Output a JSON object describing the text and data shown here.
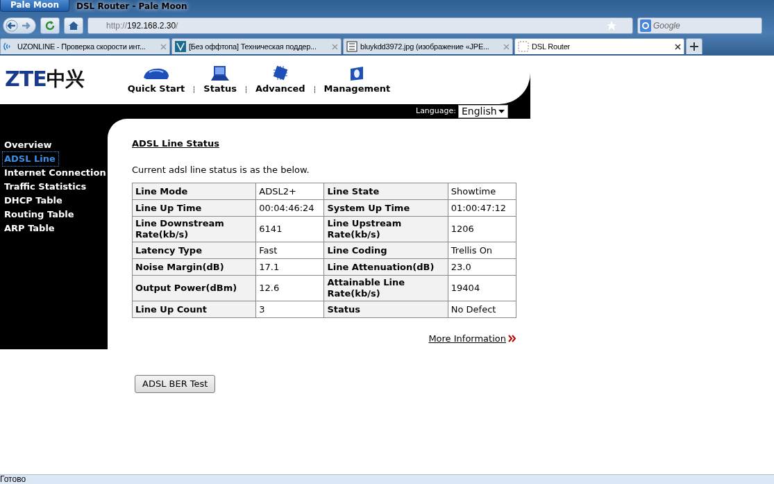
{
  "window": {
    "app_button": "Pale Moon",
    "title": "DSL Router - Pale Moon"
  },
  "toolbar": {
    "url_scheme": "http://",
    "url_host": "192.168.2.30",
    "url_rest": "/",
    "search_placeholder": "Google"
  },
  "tabs": [
    {
      "label": "UZONLINE - Проверка скорости инт...",
      "selected": false,
      "kind": "waves"
    },
    {
      "label": "[Без оффтопа] Техническая поддер...",
      "selected": false,
      "kind": "v"
    },
    {
      "label": "bluykdd3972.jpg (изображение «JPE...",
      "selected": false,
      "kind": "image"
    },
    {
      "label": "DSL Router",
      "selected": true,
      "kind": "blank"
    }
  ],
  "page": {
    "logo_latin": "ZTE",
    "logo_cjk": "中兴",
    "menu": [
      {
        "label": "Quick Start",
        "kind": "start"
      },
      {
        "label": "Status",
        "kind": "status"
      },
      {
        "label": "Advanced",
        "kind": "advanced"
      },
      {
        "label": "Management",
        "kind": "management"
      }
    ],
    "language_label": "Language:",
    "language_value": "English",
    "sidebar": [
      {
        "label": "Overview",
        "selected": false
      },
      {
        "label": "ADSL Line",
        "selected": true
      },
      {
        "label": "Internet Connection",
        "selected": false
      },
      {
        "label": "Traffic Statistics",
        "selected": false
      },
      {
        "label": "DHCP Table",
        "selected": false
      },
      {
        "label": "Routing Table",
        "selected": false
      },
      {
        "label": "ARP Table",
        "selected": false
      }
    ],
    "heading": "ADSL Line Status",
    "intro": "Current adsl line status is as the below.",
    "table": {
      "rows": [
        [
          "Line Mode",
          "ADSL2+",
          "Line State",
          "Showtime"
        ],
        [
          "Line Up Time",
          "00:04:46:24",
          "System Up Time",
          "01:00:47:12"
        ],
        [
          "Line Downstream Rate(kb/s)",
          "6141",
          "Line Upstream Rate(kb/s)",
          "1206"
        ],
        [
          "Latency Type",
          "Fast",
          "Line Coding",
          "Trellis On"
        ],
        [
          "Noise Margin(dB)",
          "17.1",
          "Line Attenuation(dB)",
          "23.0"
        ],
        [
          "Output Power(dBm)",
          "12.6",
          "Attainable Line Rate(kb/s)",
          "19404"
        ],
        [
          "Line Up Count",
          "3",
          "Status",
          "No Defect"
        ]
      ]
    },
    "more_link": "More Information",
    "button": "ADSL BER Test"
  },
  "status_bar": "Готово"
}
